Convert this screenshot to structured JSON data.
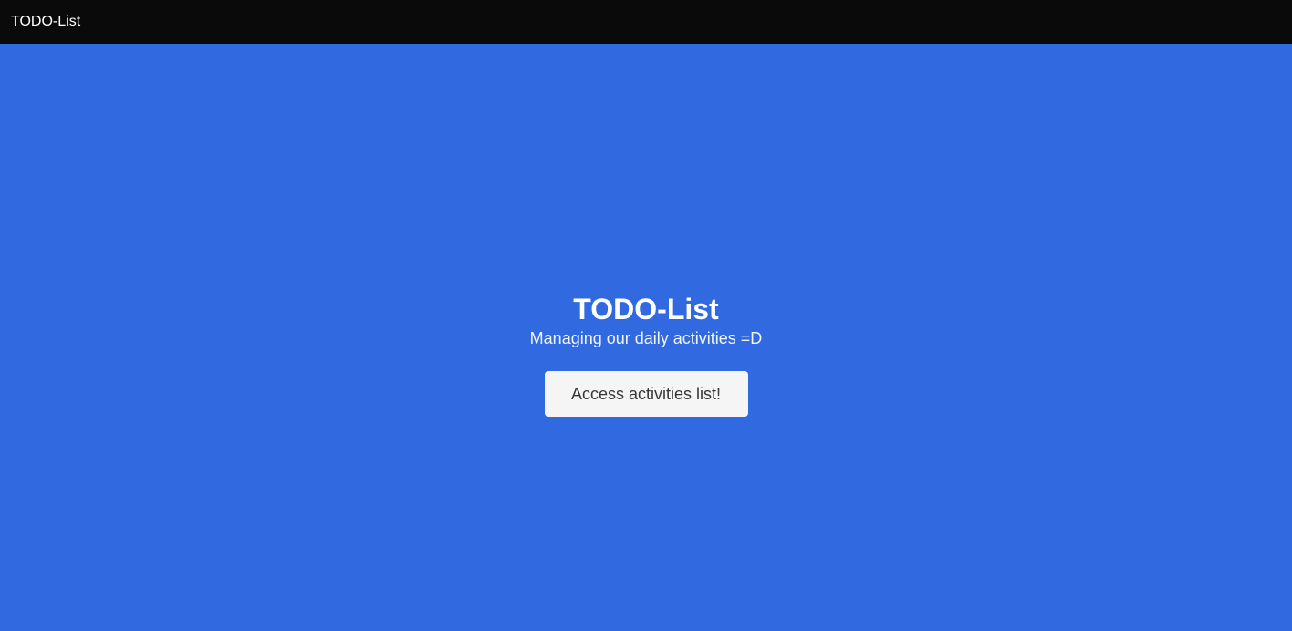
{
  "navbar": {
    "brand": "TODO-List",
    "background": "#0a0a0a"
  },
  "hero": {
    "title": "TODO-List",
    "subtitle": "Managing our daily activities =D",
    "button_label": "Access activities list!",
    "background": "#3069e0"
  }
}
